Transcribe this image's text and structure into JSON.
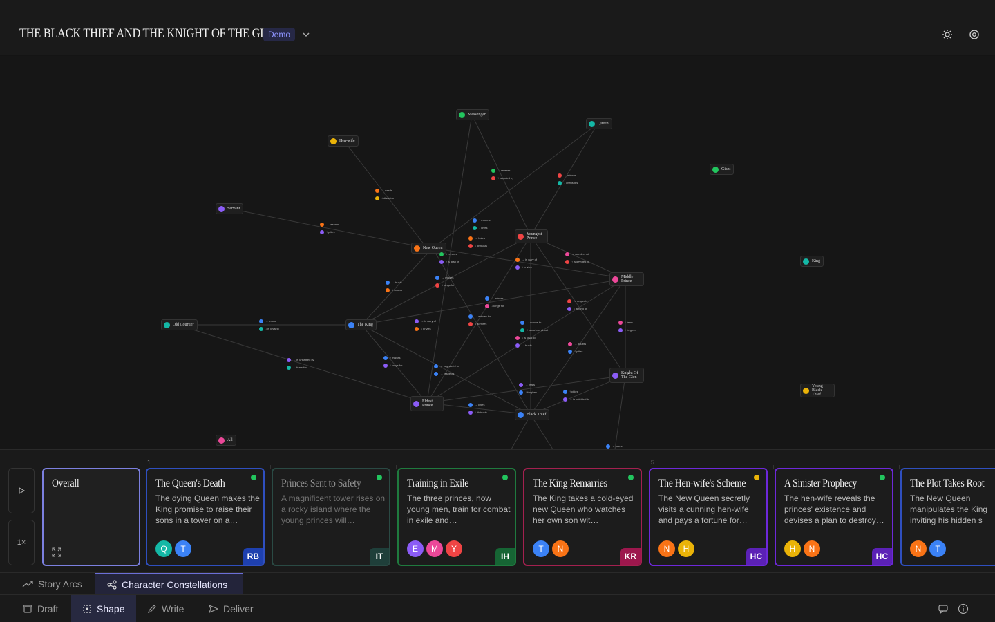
{
  "header": {
    "title": "THE BLACK THIEF AND THE KNIGHT OF THE GLEN",
    "badge": "Demo"
  },
  "graph": {
    "nodes": [
      {
        "id": "messenger",
        "initial": "M",
        "name": "Messenger",
        "color": "#22c55e"
      },
      {
        "id": "queen",
        "initial": "Q",
        "name": "Queen",
        "color": "#14b8a6"
      },
      {
        "id": "henwife",
        "initial": "H",
        "name": "Hen-wife",
        "color": "#eab308"
      },
      {
        "id": "giant",
        "initial": "G",
        "name": "Giant",
        "color": "#22c55e"
      },
      {
        "id": "servant",
        "initial": "S",
        "name": "Servant",
        "color": "#8b5cf6"
      },
      {
        "id": "youngest",
        "initial": "YP",
        "name": "Youngest Prince",
        "color": "#ef4444"
      },
      {
        "id": "newqueen",
        "initial": "NQ",
        "name": "New Queen",
        "color": "#f97316"
      },
      {
        "id": "king2",
        "initial": "K",
        "name": "King",
        "color": "#14b8a6"
      },
      {
        "id": "middle",
        "initial": "MP",
        "name": "Middle Prince",
        "color": "#ec4899"
      },
      {
        "id": "oldcourtier",
        "initial": "OC",
        "name": "Old Courtier",
        "color": "#14b8a6"
      },
      {
        "id": "theking",
        "initial": "TK",
        "name": "The King",
        "color": "#3b82f6"
      },
      {
        "id": "knight",
        "initial": "KG",
        "name": "Knight Of The Glen",
        "color": "#8b5cf6"
      },
      {
        "id": "youngblack",
        "initial": "Y",
        "name": "Young Black Thief",
        "color": "#eab308"
      },
      {
        "id": "eldest",
        "initial": "EP",
        "name": "Eldest Prince",
        "color": "#8b5cf6"
      },
      {
        "id": "blackthief",
        "initial": "BT",
        "name": "Black Thief",
        "color": "#3b82f6"
      },
      {
        "id": "all",
        "initial": "A",
        "name": "All",
        "color": "#ec4899"
      }
    ],
    "edge_labels": [
      [
        "M",
        "→ reveres",
        "#22c55e",
        "Y",
        "↑ is elated by",
        "#ef4444"
      ],
      [
        "Y",
        "→ misses",
        "#ef4444",
        "Q",
        "↓ cherishes",
        "#14b8a6"
      ],
      [
        "N",
        "→ needs",
        "#f97316",
        "H",
        "↓ disdains",
        "#eab308"
      ],
      [
        "N",
        "→ resents",
        "#f97316",
        "S",
        "↑ pities",
        "#8b5cf6"
      ],
      [
        "T",
        "↑ mourns",
        "#3b82f6",
        "Q",
        "↓ loves",
        "#14b8a6"
      ],
      [
        "N",
        "→ hates",
        "#f97316",
        "Y",
        "↓ distrusts",
        "#ef4444"
      ],
      [
        "M",
        "↓ reveres",
        "#22c55e",
        "E",
        "↑ is glad of",
        "#8b5cf6"
      ],
      [
        "N",
        "→ is wary of",
        "#f97316",
        "E",
        "↓ envies",
        "#8b5cf6"
      ],
      [
        "M",
        "→ wonders at",
        "#ec4899",
        "Y",
        "↑ is devoted to",
        "#ef4444"
      ],
      [
        "T",
        "→ trusts",
        "#3b82f6",
        "N",
        "↓ scorns",
        "#f97316"
      ],
      [
        "T",
        "→ misses",
        "#3b82f6",
        "Y",
        "↓ longs for",
        "#ef4444"
      ],
      [
        "T",
        "→ misses",
        "#3b82f6",
        "M",
        "↓ longs for",
        "#ec4899"
      ],
      [
        "Y",
        "→ respects",
        "#ef4444",
        "M",
        "↓ is fond of",
        "#8b5cf6"
      ],
      [
        "O",
        "→ trusts",
        "#3b82f6",
        "T",
        "↓ is loyal to",
        "#14b8a6"
      ],
      [
        "T",
        "→ is wary of",
        "#8b5cf6",
        "N",
        "↓ envies",
        "#f97316"
      ],
      [
        "E",
        "→ worries for",
        "#3b82f6",
        "Y",
        "↓ admires",
        "#ef4444"
      ],
      [
        "M",
        "↓ fears",
        "#ec4899",
        "K",
        "↑ forgives",
        "#8b5cf6"
      ],
      [
        "Y",
        "→ warms to",
        "#3b82f6",
        "B",
        "↑ is curious about",
        "#14b8a6"
      ],
      [
        "M",
        "↓ is loyal to",
        "#ec4899",
        "B",
        "→ trusts",
        "#8b5cf6"
      ],
      [
        "M",
        "→ doubts",
        "#ec4899",
        "B",
        "↓ pities",
        "#3b82f6"
      ],
      [
        "O",
        "← is unsettled by",
        "#8b5cf6",
        "T",
        "→ fears for",
        "#14b8a6"
      ],
      [
        "T",
        "↑ misses",
        "#3b82f6",
        "E",
        "↓ longs for",
        "#8b5cf6"
      ],
      [
        "T",
        "← is grateful to",
        "#3b82f6",
        "E",
        "→ respects",
        "#3b82f6"
      ],
      [
        "K",
        "→ fears",
        "#8b5cf6",
        "B",
        "↓ forgives",
        "#3b82f6"
      ],
      [
        "B",
        "↑ pities",
        "#3b82f6",
        "K",
        "→ is indebted to",
        "#8b5cf6"
      ],
      [
        "E",
        "→ pities",
        "#3b82f6",
        "B",
        "↓ distrusts",
        "#8b5cf6"
      ],
      [
        "B",
        "← loves",
        "#3b82f6",
        "",
        "",
        ""
      ]
    ]
  },
  "timeline": {
    "speed": "1×",
    "ticks": [
      "1",
      "5"
    ],
    "cards": [
      {
        "title": "Overall",
        "desc": "",
        "status": "",
        "avatars": [],
        "badge": "",
        "badge_color": "",
        "border": "#7c80e0"
      },
      {
        "title": "The Queen's Death",
        "desc": "The dying Queen makes the King promise to raise their sons in a tower on a…",
        "status": "#22c55e",
        "avatars": [
          {
            "l": "Q",
            "c": "#14b8a6"
          },
          {
            "l": "T",
            "c": "#3b82f6"
          }
        ],
        "badge": "RB",
        "badge_color": "#1e40af",
        "border": "#2f4fbf"
      },
      {
        "title": "Princes Sent to Safety",
        "desc": "A magnificent tower rises on a rocky island where the young princes will…",
        "status": "#22c55e",
        "avatars": [],
        "badge": "IT",
        "badge_color": "#1f3f3a",
        "border": "#2a4a44"
      },
      {
        "title": "Training in Exile",
        "desc": "The three princes, now young men, train for combat in exile and…",
        "status": "#22c55e",
        "avatars": [
          {
            "l": "E",
            "c": "#8b5cf6"
          },
          {
            "l": "M",
            "c": "#ec4899"
          },
          {
            "l": "Y",
            "c": "#ef4444"
          }
        ],
        "badge": "IH",
        "badge_color": "#166534",
        "border": "#1f7a3e"
      },
      {
        "title": "The King Remarries",
        "desc": "The King takes a cold-eyed new Queen who watches her own son wit…",
        "status": "#22c55e",
        "avatars": [
          {
            "l": "T",
            "c": "#3b82f6"
          },
          {
            "l": "N",
            "c": "#f97316"
          }
        ],
        "badge": "KR",
        "badge_color": "#9d174d",
        "border": "#a3204f"
      },
      {
        "title": "The Hen-wife's Scheme",
        "desc": "The New Queen secretly visits a cunning hen-wife and pays a fortune for…",
        "status": "#eab308",
        "avatars": [
          {
            "l": "N",
            "c": "#f97316"
          },
          {
            "l": "H",
            "c": "#eab308"
          }
        ],
        "badge": "HC",
        "badge_color": "#5b21b6",
        "border": "#6d28d9"
      },
      {
        "title": "A Sinister Prophecy",
        "desc": "The hen-wife reveals the princes' existence and devises a plan to destroy…",
        "status": "#22c55e",
        "avatars": [
          {
            "l": "H",
            "c": "#eab308"
          },
          {
            "l": "N",
            "c": "#f97316"
          }
        ],
        "badge": "HC",
        "badge_color": "#5b21b6",
        "border": "#6d28d9"
      },
      {
        "title": "The Plot Takes Root",
        "desc": "The New Queen manipulates the King inviting his hidden s",
        "status": "",
        "avatars": [
          {
            "l": "N",
            "c": "#f97316"
          },
          {
            "l": "T",
            "c": "#3b82f6"
          }
        ],
        "badge": "",
        "badge_color": "",
        "border": "#2f4fbf"
      }
    ]
  },
  "views": {
    "story_arcs": "Story Arcs",
    "constellations": "Character Constellations"
  },
  "modes": {
    "draft": "Draft",
    "shape": "Shape",
    "write": "Write",
    "deliver": "Deliver"
  }
}
